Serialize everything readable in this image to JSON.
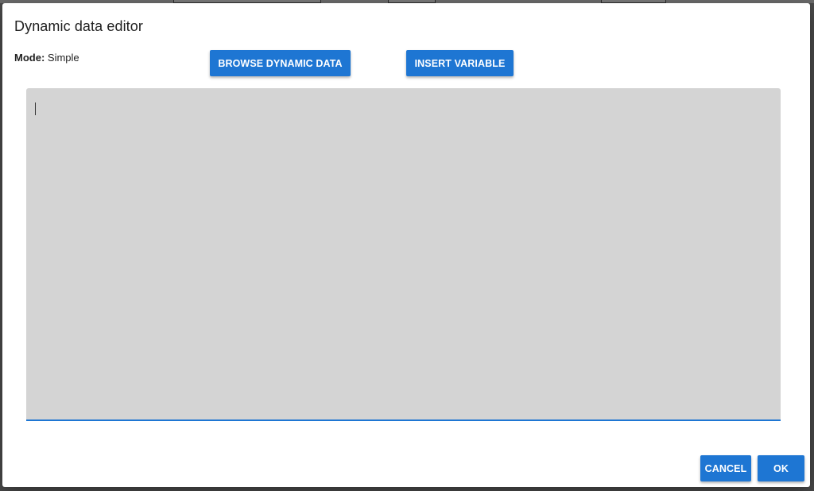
{
  "dialog": {
    "title": "Dynamic data editor",
    "mode_label": "Mode:",
    "mode_value": "Simple"
  },
  "toolbar": {
    "browse_label": "BROWSE DYNAMIC DATA",
    "insert_label": "INSERT VARIABLE"
  },
  "editor": {
    "value": "",
    "placeholder": ""
  },
  "footer": {
    "cancel_label": "CANCEL",
    "ok_label": "OK"
  },
  "colors": {
    "accent": "#1e76d3",
    "editor_bg": "#d4d4d4"
  }
}
